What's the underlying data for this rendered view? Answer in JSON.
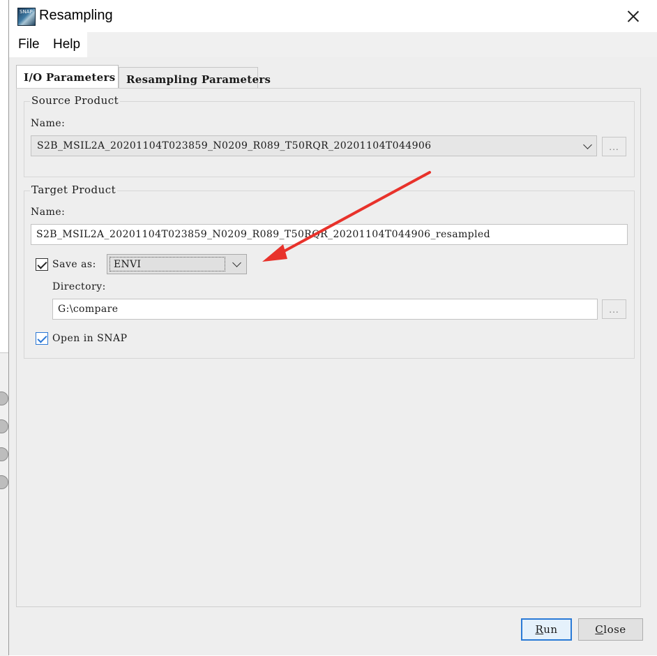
{
  "window": {
    "title": "Resampling",
    "icon": "snap-app-icon"
  },
  "menubar": {
    "items": [
      "File",
      "Help"
    ]
  },
  "tabs": [
    {
      "label": "I/O Parameters",
      "active": true
    },
    {
      "label": "Resampling Parameters",
      "active": false
    }
  ],
  "source_product": {
    "group_title": "Source Product",
    "name_label": "Name:",
    "selected_product": "S2B_MSIL2A_20201104T023859_N0209_R089_T50RQR_20201104T044906",
    "browse_label": "..."
  },
  "target_product": {
    "group_title": "Target Product",
    "name_label": "Name:",
    "name_value": "S2B_MSIL2A_20201104T023859_N0209_R089_T50RQR_20201104T044906_resampled",
    "save_as_label": "Save as:",
    "save_as_checked": true,
    "format_value": "ENVI",
    "directory_label": "Directory:",
    "directory_value": "G:\\compare",
    "browse_label": "...",
    "open_in_snap_label": "Open in SNAP",
    "open_in_snap_checked": true
  },
  "buttons": {
    "run": "Run",
    "close": "Close"
  },
  "annotation": {
    "color": "#e8322b"
  }
}
